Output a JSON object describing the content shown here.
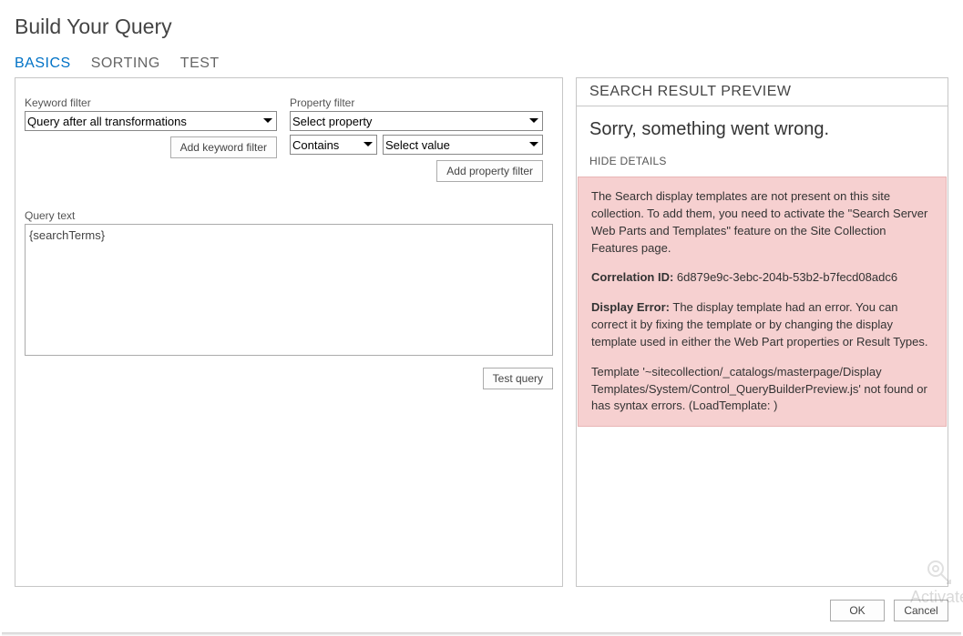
{
  "title": "Build Your Query",
  "tabs": {
    "basics": "BASICS",
    "sorting": "SORTING",
    "test": "TEST"
  },
  "filters": {
    "keyword_label": "Keyword filter",
    "keyword_selected": "Query after all transformations",
    "add_keyword_btn": "Add keyword filter",
    "property_label": "Property filter",
    "property_selected": "Select property",
    "operator_selected": "Contains",
    "value_selected": "Select value",
    "add_property_btn": "Add property filter"
  },
  "query_text": {
    "label": "Query text",
    "value": "{searchTerms}",
    "test_btn": "Test query"
  },
  "preview": {
    "header": "SEARCH RESULT PREVIEW",
    "sorry": "Sorry, something went wrong.",
    "hide_details": "HIDE DETAILS",
    "err_p1": "The Search display templates are not present on this site collection. To add them, you need to activate the \"Search Server Web Parts and Templates\" feature on the Site Collection Features page.",
    "corr_label": "Correlation ID:",
    "corr_value": "6d879e9c-3ebc-204b-53b2-b7fecd08adc6",
    "disp_label": "Display Error:",
    "disp_value": "The display template had an error. You can correct it by fixing the template or by changing the display template used in either the Web Part properties or Result Types.",
    "err_p4": "Template '~sitecollection/_catalogs/masterpage/Display Templates/System/Control_QueryBuilderPreview.js' not found or has syntax errors. (LoadTemplate: )"
  },
  "footer": {
    "ok": "OK",
    "cancel": "Cancel"
  },
  "watermark": {
    "text": "Activate"
  }
}
